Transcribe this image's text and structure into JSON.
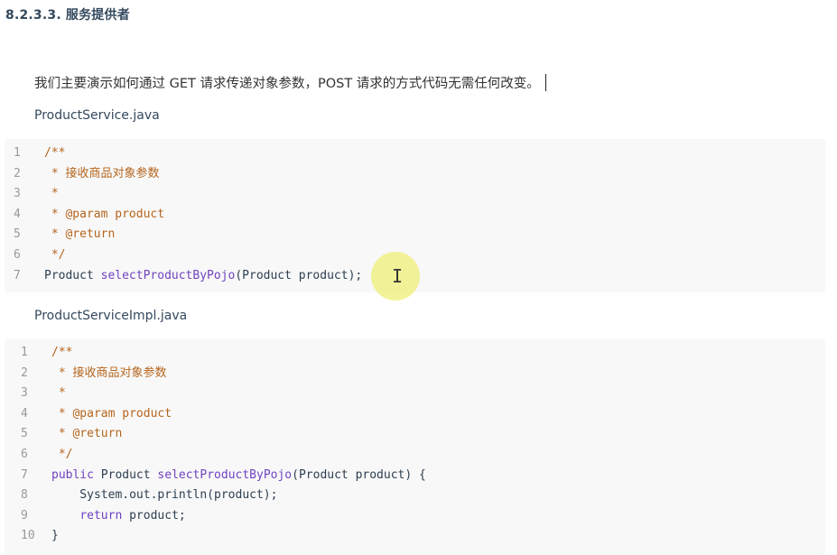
{
  "heading": "8.2.3.3. 服务提供者",
  "intro": "我们主要演示如何通过 GET 请求传递对象参数，POST 请求的方式代码无需任何改变。",
  "files": [
    {
      "name": "ProductService.java",
      "lines": [
        {
          "n": "1",
          "parts": [
            {
              "t": "/**",
              "c": "comment"
            }
          ]
        },
        {
          "n": "2",
          "parts": [
            {
              "t": " * 接收商品对象参数",
              "c": "comment"
            }
          ]
        },
        {
          "n": "3",
          "parts": [
            {
              "t": " *",
              "c": "comment"
            }
          ]
        },
        {
          "n": "4",
          "parts": [
            {
              "t": " * @param product",
              "c": "comment"
            }
          ]
        },
        {
          "n": "5",
          "parts": [
            {
              "t": " * @return",
              "c": "comment"
            }
          ]
        },
        {
          "n": "6",
          "parts": [
            {
              "t": " */",
              "c": "comment"
            }
          ]
        },
        {
          "n": "7",
          "parts": [
            {
              "t": "Product ",
              "c": "plain"
            },
            {
              "t": "selectProductByPojo",
              "c": "fn"
            },
            {
              "t": "(Product product);",
              "c": "plain"
            }
          ]
        }
      ]
    },
    {
      "name": "ProductServiceImpl.java",
      "lines": [
        {
          "n": "1",
          "parts": [
            {
              "t": "/**",
              "c": "comment"
            }
          ]
        },
        {
          "n": "2",
          "parts": [
            {
              "t": " * 接收商品对象参数",
              "c": "comment"
            }
          ]
        },
        {
          "n": "3",
          "parts": [
            {
              "t": " *",
              "c": "comment"
            }
          ]
        },
        {
          "n": "4",
          "parts": [
            {
              "t": " * @param product",
              "c": "comment"
            }
          ]
        },
        {
          "n": "5",
          "parts": [
            {
              "t": " * @return",
              "c": "comment"
            }
          ]
        },
        {
          "n": "6",
          "parts": [
            {
              "t": " */",
              "c": "comment"
            }
          ]
        },
        {
          "n": "7",
          "parts": [
            {
              "t": "public ",
              "c": "kw"
            },
            {
              "t": "Product ",
              "c": "plain"
            },
            {
              "t": "selectProductByPojo",
              "c": "fn"
            },
            {
              "t": "(Product product) {",
              "c": "plain"
            }
          ]
        },
        {
          "n": "8",
          "parts": [
            {
              "t": "    System.out.println(product);",
              "c": "plain"
            }
          ]
        },
        {
          "n": "9",
          "parts": [
            {
              "t": "    ",
              "c": "plain"
            },
            {
              "t": "return ",
              "c": "kw"
            },
            {
              "t": "product;",
              "c": "plain"
            }
          ]
        },
        {
          "n": "10",
          "parts": [
            {
              "t": "}",
              "c": "plain"
            }
          ]
        }
      ]
    }
  ],
  "colors": {
    "comment": "#b5651d",
    "function": "#6f42c1",
    "code_bg": "#f8f8f8",
    "cursor_halo": "#eeee6e"
  },
  "icons": {
    "cursor": "text-cursor-icon"
  }
}
